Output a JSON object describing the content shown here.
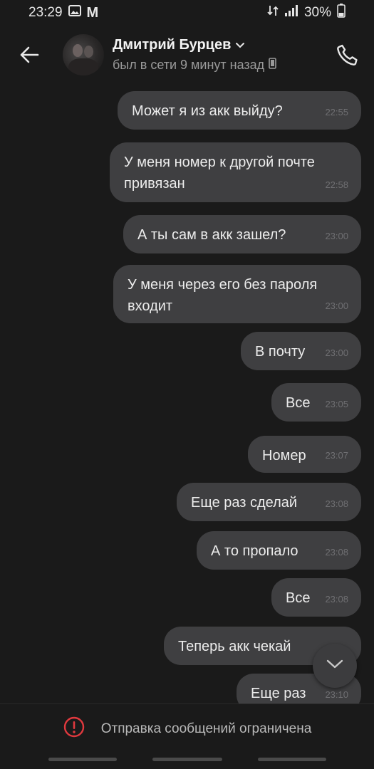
{
  "status_bar": {
    "time": "23:29",
    "mail_glyph": "M",
    "battery": "30%",
    "icons": [
      "image-icon",
      "data-transfer-icon",
      "signal-icon",
      "battery-icon"
    ]
  },
  "header": {
    "contact_name": "Дмитрий Бурцев",
    "last_seen": "был в сети 9 минут назад",
    "icons": [
      "back-arrow-icon",
      "chevron-down-icon",
      "mobile-device-icon",
      "phone-icon"
    ]
  },
  "messages": [
    {
      "text": "Может я из акк выйду?",
      "time": "22:55"
    },
    {
      "text": "У меня номер к другой почте привязан",
      "time": "22:58"
    },
    {
      "text": "А ты сам в акк зашел?",
      "time": "23:00"
    },
    {
      "text": "У меня через его без пароля входит",
      "time": "23:00"
    },
    {
      "text": "В почту",
      "time": "23:00"
    },
    {
      "text": "Все",
      "time": "23:05"
    },
    {
      "text": "Номер",
      "time": "23:07"
    },
    {
      "text": "Еще раз сделай",
      "time": "23:08"
    },
    {
      "text": "А то пропало",
      "time": "23:08"
    },
    {
      "text": "Все",
      "time": "23:08"
    },
    {
      "text": "Теперь акк чекай",
      "time": ""
    },
    {
      "text": "Еще раз",
      "time": "23:10"
    }
  ],
  "bottom": {
    "restriction_text": "Отправка сообщений ограничена",
    "icon": "warning-circle-icon"
  },
  "colors": {
    "background": "#1a1a1a",
    "bubble": "#3f3f41",
    "warning": "#e0393e"
  }
}
